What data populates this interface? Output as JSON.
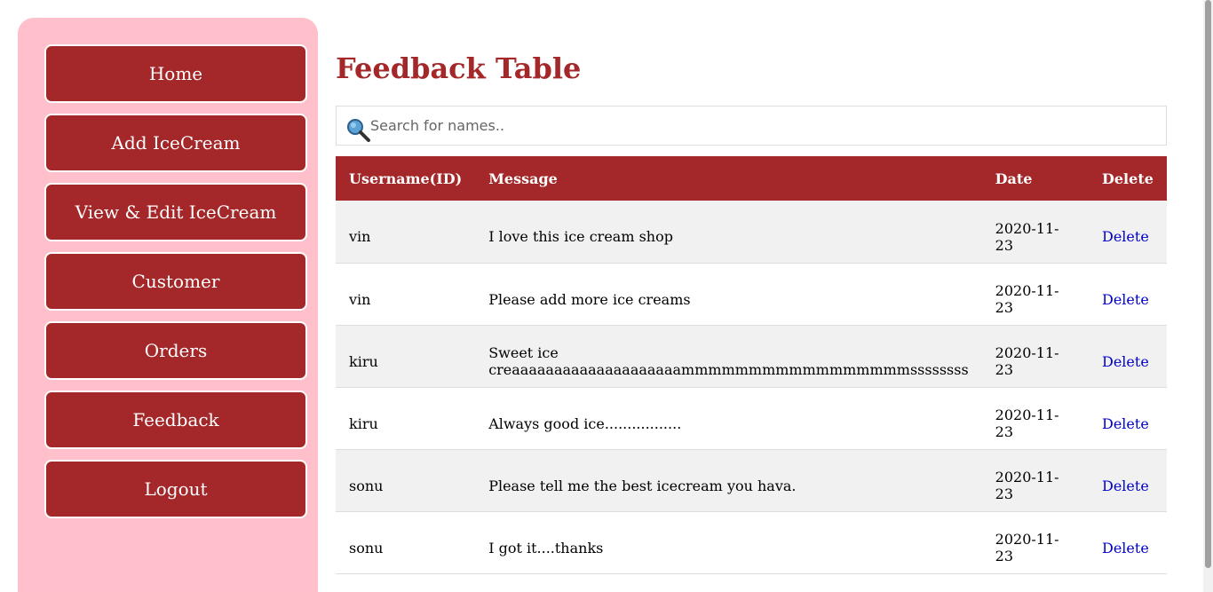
{
  "sidebar": {
    "items": [
      {
        "label": "Home"
      },
      {
        "label": "Add IceCream"
      },
      {
        "label": "View & Edit IceCream"
      },
      {
        "label": "Customer"
      },
      {
        "label": "Orders"
      },
      {
        "label": "Feedback"
      },
      {
        "label": "Logout"
      }
    ]
  },
  "main": {
    "title": "Feedback Table",
    "search": {
      "placeholder": "Search for names..",
      "value": "",
      "icon": "magnifying-glass-icon"
    },
    "table": {
      "headers": [
        "Username(ID)",
        "Message",
        "Date",
        "Delete"
      ],
      "rows": [
        {
          "username": "vin",
          "message": "I love this ice cream shop",
          "date": "2020-11-23",
          "action": "Delete"
        },
        {
          "username": "vin",
          "message": "Please add more ice creams",
          "date": "2020-11-23",
          "action": "Delete"
        },
        {
          "username": "kiru",
          "message": "Sweet ice creaaaaaaaaaaaaaaaaaaaammmmmmmmmmmmmmmmmssssssss",
          "date": "2020-11-23",
          "action": "Delete"
        },
        {
          "username": "kiru",
          "message": "Always good ice.................",
          "date": "2020-11-23",
          "action": "Delete"
        },
        {
          "username": "sonu",
          "message": "Please tell me the best icecream you hava.",
          "date": "2020-11-23",
          "action": "Delete"
        },
        {
          "username": "sonu",
          "message": "I got it....thanks",
          "date": "2020-11-23",
          "action": "Delete"
        }
      ]
    }
  },
  "colors": {
    "primary": "#a4282a",
    "sidebar_bg": "#ffc0cb",
    "link": "#0000cc",
    "row_alt": "#f1f1f1"
  }
}
